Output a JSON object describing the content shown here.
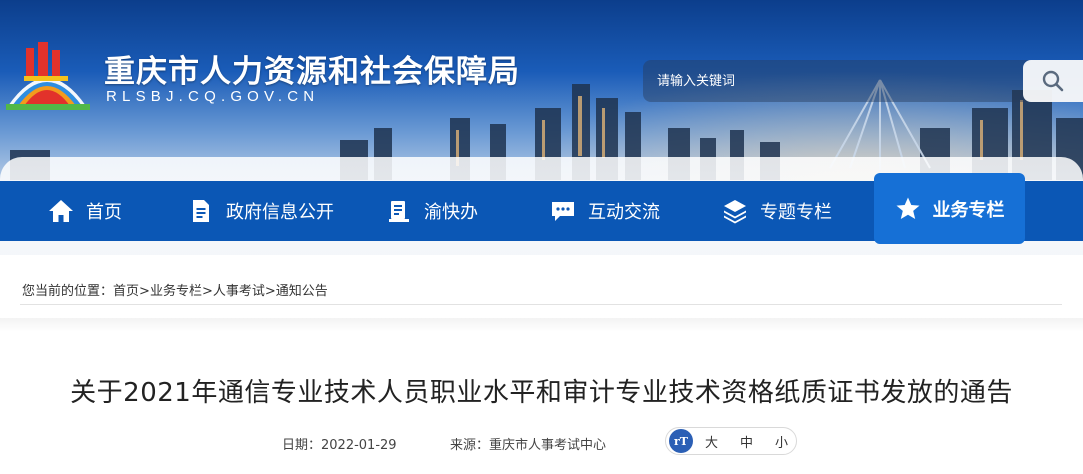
{
  "header": {
    "site_title": "重庆市人力资源和社会保障局",
    "site_domain": "RLSBJ.CQ.GOV.CN",
    "search_placeholder": "请输入关键词"
  },
  "nav": {
    "items": [
      {
        "label": "首页",
        "icon": "home-icon"
      },
      {
        "label": "政府信息公开",
        "icon": "document-icon"
      },
      {
        "label": "渝快办",
        "icon": "clipboard-icon"
      },
      {
        "label": "互动交流",
        "icon": "chat-icon"
      },
      {
        "label": "专题专栏",
        "icon": "layers-icon"
      },
      {
        "label": "业务专栏",
        "icon": "star-icon",
        "active": true
      }
    ]
  },
  "breadcrumb": {
    "prefix": "您当前的位置：",
    "items": [
      "首页",
      "业务专栏",
      "人事考试",
      "通知公告"
    ],
    "separator": ">"
  },
  "article": {
    "title": "关于2021年通信专业技术人员职业水平和审计专业技术资格纸质证书发放的通告",
    "date_label": "日期：2022-01-29",
    "source_label": "来源：重庆市人事考试中心",
    "font_sizes": [
      "大",
      "中",
      "小"
    ],
    "font_icon_text": "rT"
  },
  "colors": {
    "nav_bg": "#0b57b5",
    "nav_active": "#1670d6",
    "accent_blue": "#2b5fb5"
  }
}
